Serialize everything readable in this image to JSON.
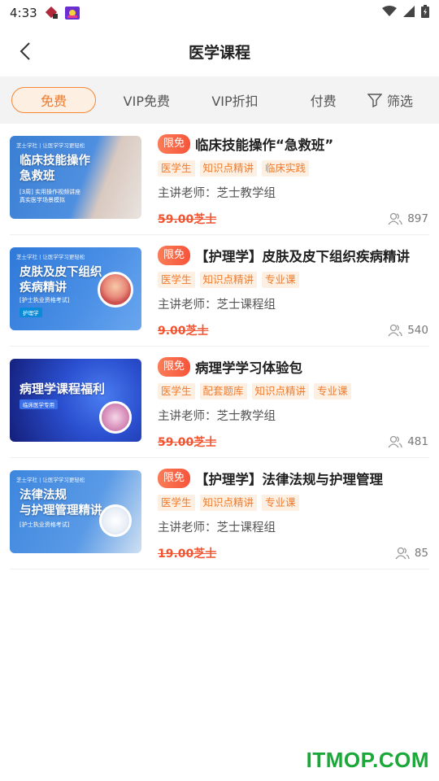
{
  "status_bar": {
    "time": "4:33"
  },
  "header": {
    "title": "医学课程"
  },
  "tabs": [
    {
      "label": "免费",
      "active": true
    },
    {
      "label": "VIP免费"
    },
    {
      "label": "VIP折扣"
    },
    {
      "label": "付费"
    }
  ],
  "filter": {
    "label": "筛选"
  },
  "courses": [
    {
      "badge": "限免",
      "title": "临床技能操作“急救班”",
      "tags": [
        "医学生",
        "知识点精讲",
        "临床实践"
      ],
      "teacher": "主讲老师：芝士教学组",
      "price": "59.00芝士",
      "count": "897",
      "thumb": {
        "brand": "芝士学社 | 让医学学习更轻松",
        "title": "临床技能操作\n急救班",
        "sub": "[3周] 实用操作视频讲座\n真实医学场景模拟",
        "bg": "#3a7fd3"
      }
    },
    {
      "badge": "限免",
      "title": "【护理学】皮肤及皮下组织疾病精讲",
      "tags": [
        "医学生",
        "知识点精讲",
        "专业课"
      ],
      "teacher": "主讲老师：芝士课程组",
      "price": "9.00芝士",
      "count": "540",
      "thumb": {
        "brand": "芝士学社 | 让医学学习更轻松",
        "title": "皮肤及皮下组织\n疾病精讲",
        "sub": "[护士执业资格考试]",
        "chip": "护理学",
        "bg": "#2f79d9"
      }
    },
    {
      "badge": "限免",
      "title": "病理学学习体验包",
      "tags": [
        "医学生",
        "配套题库",
        "知识点精讲",
        "专业课"
      ],
      "teacher": "主讲老师：芝士教学组",
      "price": "59.00芝士",
      "count": "481",
      "thumb": {
        "title": "病理学课程福利",
        "chip": "临床医学专用",
        "bg": "#1a3ea8"
      }
    },
    {
      "badge": "限免",
      "title": "【护理学】法律法规与护理管理",
      "tags": [
        "医学生",
        "知识点精讲",
        "专业课"
      ],
      "teacher": "主讲老师：芝士课程组",
      "price": "19.00芝士",
      "count": "85",
      "thumb": {
        "brand": "芝士学社 | 让医学学习更轻松",
        "title": "法律法规\n与护理管理精讲",
        "sub": "[护士执业资格考试]",
        "bg": "#3d86de"
      }
    }
  ],
  "watermark": "ITMOP.COM",
  "colors": {
    "accent": "#f07a2a",
    "price": "#f2542f",
    "badge": "#f6543b",
    "watermark": "#1aa838"
  }
}
